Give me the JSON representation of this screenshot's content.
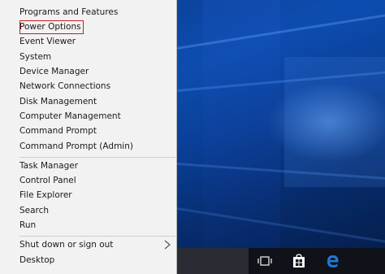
{
  "menu": {
    "items": [
      {
        "label": "Programs and Features"
      },
      {
        "label": "Power Options"
      },
      {
        "label": "Event Viewer"
      },
      {
        "label": "System"
      },
      {
        "label": "Device Manager"
      },
      {
        "label": "Network Connections"
      },
      {
        "label": "Disk Management"
      },
      {
        "label": "Computer Management"
      },
      {
        "label": "Command Prompt"
      },
      {
        "label": "Command Prompt (Admin)"
      },
      {
        "label": "Task Manager"
      },
      {
        "label": "Control Panel"
      },
      {
        "label": "File Explorer"
      },
      {
        "label": "Search"
      },
      {
        "label": "Run"
      },
      {
        "label": "Shut down or sign out"
      },
      {
        "label": "Desktop"
      }
    ],
    "highlighted_item": "Power Options",
    "submenu_icon": "chevron-right-icon"
  },
  "taskbar": {
    "icons": [
      "task-view-icon",
      "store-icon",
      "edge-icon"
    ]
  },
  "colors": {
    "menu_background": "#f2f2f2",
    "highlight_border": "#cc1b1b",
    "taskbar": "#10121a",
    "wallpaper": "#0d4db0",
    "edge_blue": "#1f7ad6"
  }
}
